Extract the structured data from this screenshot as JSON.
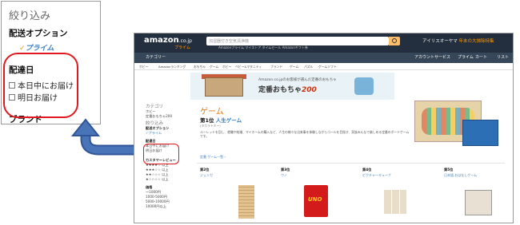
{
  "zoom": {
    "title": "絞り込み",
    "shipping_heading": "配送オプション",
    "prime_label": "プライム",
    "prime_check": "✓",
    "delivery_heading": "配達日",
    "options": [
      "本日中にお届け",
      "明日お届け"
    ],
    "brand_heading": "ブランド"
  },
  "site": {
    "logo": "amazon",
    "logo_suffix": ".co.jp",
    "prime_sub": "プライム",
    "search_placeholder": "加湿器付き空気清浄機",
    "promo_brand": "アイリスオーヤマ",
    "promo_text": "年末の大掃除特集",
    "topline": "Amazonプライム   マイストア   タイムセール   Amazonギフト券",
    "categories": "カテゴリー",
    "account_label": "アカウントサービス",
    "prime_nav": "プライム",
    "cart_label": "カート",
    "list_label": "リスト",
    "subnav": [
      "ホビー",
      "Amazonランキング",
      "おもちゃ",
      "ゲーム",
      "ホビー",
      "ベビー&マタニティ",
      "ブランド",
      "ゲーム",
      "パズル",
      "ゲームソフト"
    ],
    "banner_top": "Amazon.co.jpのお客様が選んだ定番のおもちゃ",
    "banner_main": "定番おもちゃ",
    "banner_num": "200",
    "sidebar": {
      "category": "カテゴリ",
      "items": [
        "ホビー",
        "定番おもちゃ200"
      ],
      "refine": "絞り込み",
      "shipping": "配送オプション",
      "prime": "✓プライム",
      "delivery": "配達日",
      "opt1": "本日中にお届け",
      "opt2": "明日お届け",
      "review": "カスタマーレビュー",
      "star_rows": [
        "★★★★☆ 以上",
        "★★★☆☆ 以上",
        "★★☆☆☆ 以上",
        "★☆☆☆☆ 以上"
      ],
      "price": "価格",
      "prices": [
        "～1000円",
        "1000-5000円",
        "5000-10000円",
        "10000円以上"
      ]
    },
    "game_title": "ゲーム",
    "rank1_label": "第1位",
    "rank1_name": "人生ゲーム",
    "maker": "(タカラトミー)",
    "description": "ルーレットを回し、就職や結婚、マイホームの購入など、人生の様々な出来事を体験しながらゴールを目指す、家族みんなで楽しめる定番のボードゲームです。",
    "more_link": "定番 ゲーム一覧 ›",
    "ranks": [
      {
        "label": "第2位",
        "name": "ジェンガ"
      },
      {
        "label": "第3位",
        "name": "ウノ"
      },
      {
        "label": "第4位",
        "name": "ピクチャーキューブ"
      },
      {
        "label": "第5位",
        "name": "日本語 おはなしゲーム"
      }
    ]
  },
  "colors": {
    "accent_red": "#e0191e",
    "arrow_blue": "#4a74b8",
    "amazon_nav": "#232f3e",
    "orange": "#e47911"
  }
}
